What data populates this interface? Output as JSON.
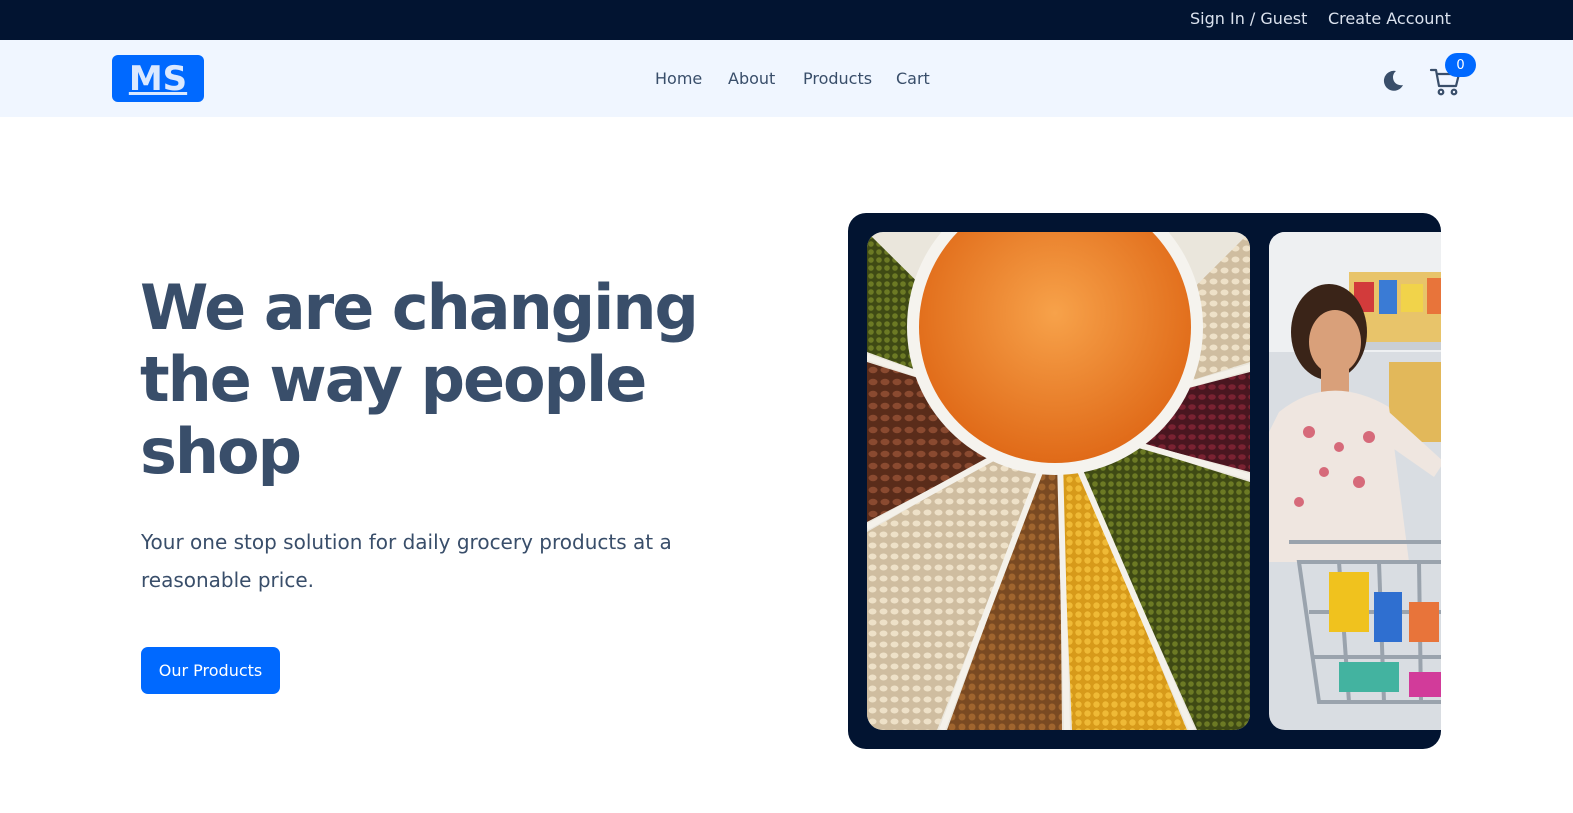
{
  "topbar": {
    "signin_label": "Sign In / Guest",
    "create_label": "Create Account"
  },
  "navbar": {
    "logo_text": "MS",
    "links": [
      {
        "label": "Home"
      },
      {
        "label": "About"
      },
      {
        "label": "Products"
      },
      {
        "label": "Cart"
      }
    ],
    "theme_icon": "moon-icon",
    "cart_icon": "cart-icon",
    "cart_count": "0"
  },
  "hero": {
    "title": "We are changing the way people shop",
    "subtitle": "Your one stop solution for daily grocery products at a reasonable price.",
    "cta_label": "Our Products"
  },
  "carousel": {
    "slides": [
      {
        "icon": "lentils-and-pulses-image"
      },
      {
        "icon": "woman-shopping-cart-image"
      }
    ]
  },
  "colors": {
    "topbar_bg": "#021431",
    "navbar_bg": "#f0f6ff",
    "primary": "#0069ff",
    "text": "#394e6a"
  }
}
